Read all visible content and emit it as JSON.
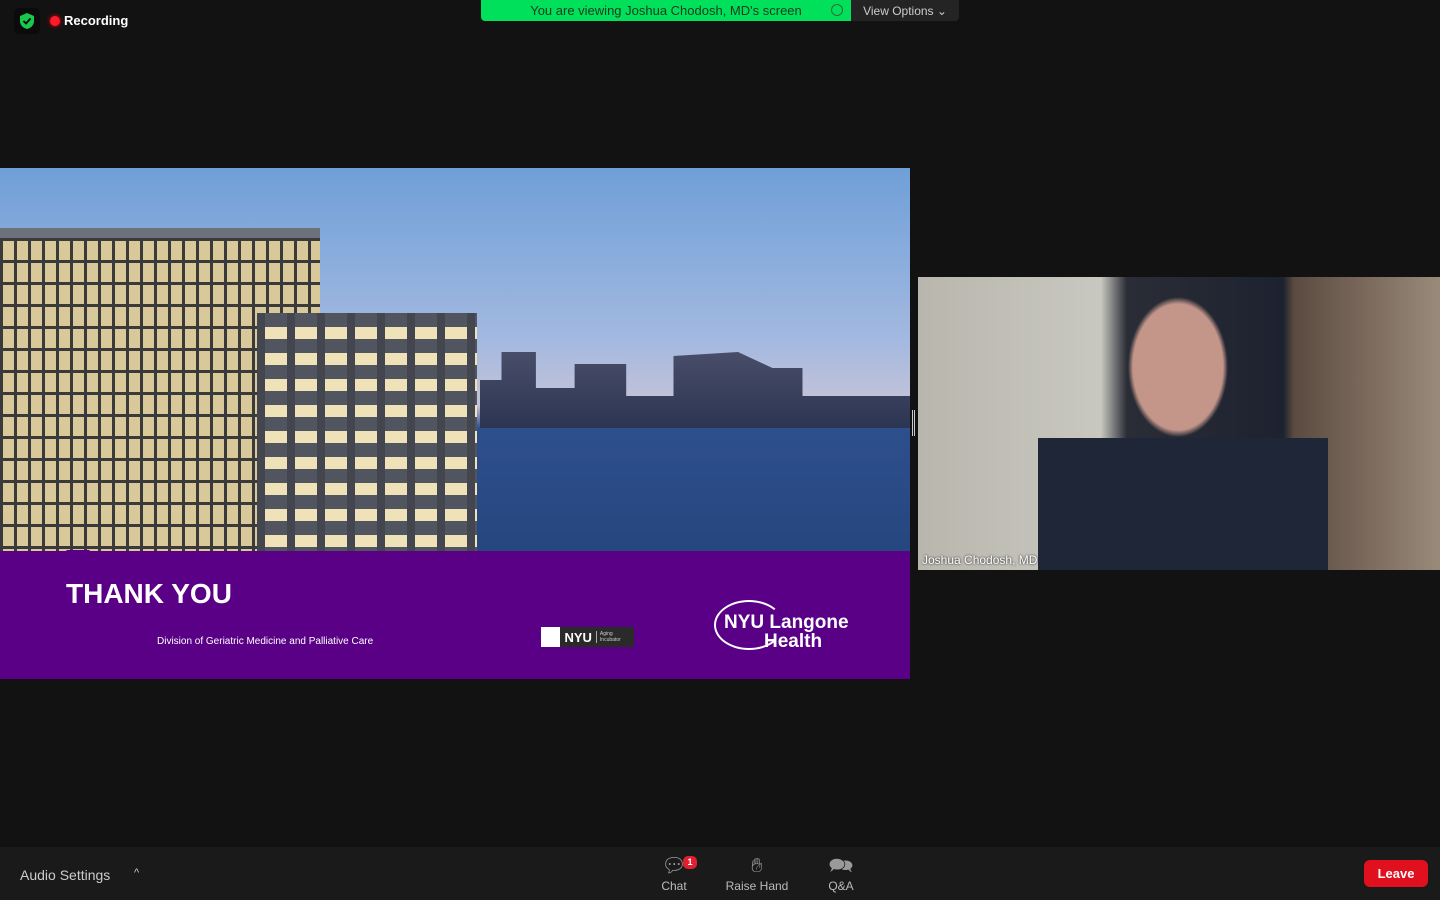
{
  "top": {
    "recording": "Recording",
    "banner": "You are viewing Joshua Chodosh, MD's screen",
    "view_options": "View Options ⌄"
  },
  "slide": {
    "title": "THANK YOU",
    "division": "Division of Geriatric Medicine and Palliative Care",
    "nyu": "NYU",
    "nyu_sub": "Aging Incubator",
    "langone_1": "NYU Langone",
    "langone_2": "Health"
  },
  "video": {
    "name": "Joshua Chodosh, MD"
  },
  "toolbar": {
    "audio": "Audio Settings",
    "caret": "^",
    "chat": "Chat",
    "chat_badge": "1",
    "raise_hand": "Raise Hand",
    "qa": "Q&A",
    "leave": "Leave"
  },
  "colors": {
    "banner": "#00e05a",
    "slide_band": "#5a0087",
    "leave": "#e0101f"
  }
}
